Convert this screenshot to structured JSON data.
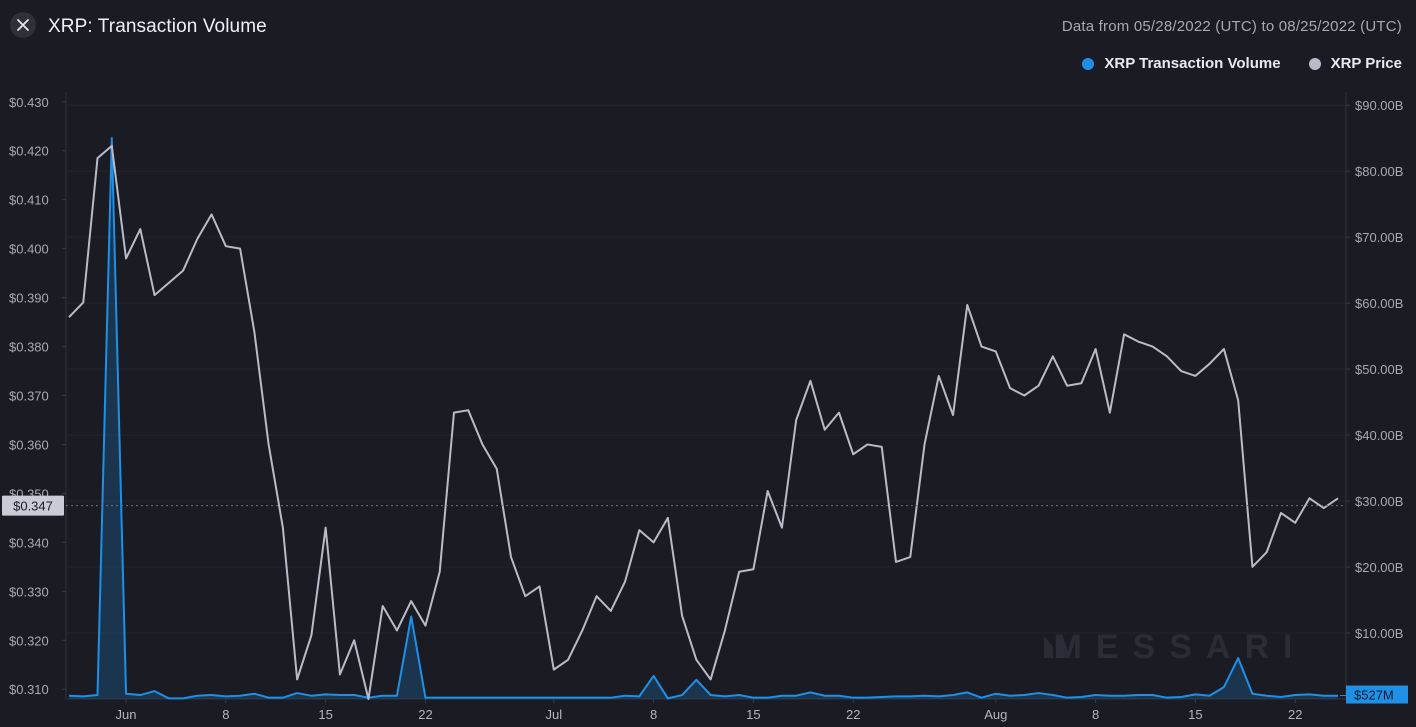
{
  "header": {
    "title": "XRP: Transaction Volume",
    "date_range": "Data from 05/28/2022 (UTC) to 08/25/2022 (UTC)",
    "close_icon": "close-icon"
  },
  "legend": [
    {
      "label": "XRP Transaction Volume",
      "color": "#1e90e8"
    },
    {
      "label": "XRP Price",
      "color": "#b9bcc8"
    }
  ],
  "watermark": "MESSARI",
  "chart_data": {
    "type": "line",
    "x_start": "2022-05-28",
    "x_end": "2022-08-25",
    "x_tick_labels": [
      {
        "date": "2022-06-01",
        "label": "Jun"
      },
      {
        "date": "2022-06-08",
        "label": "8"
      },
      {
        "date": "2022-06-15",
        "label": "15"
      },
      {
        "date": "2022-06-22",
        "label": "22"
      },
      {
        "date": "2022-07-01",
        "label": "Jul"
      },
      {
        "date": "2022-07-08",
        "label": "8"
      },
      {
        "date": "2022-07-15",
        "label": "15"
      },
      {
        "date": "2022-07-22",
        "label": "22"
      },
      {
        "date": "2022-08-01",
        "label": "Aug"
      },
      {
        "date": "2022-08-08",
        "label": "8"
      },
      {
        "date": "2022-08-15",
        "label": "15"
      },
      {
        "date": "2022-08-22",
        "label": "22"
      }
    ],
    "left_axis": {
      "ylim": [
        0.308,
        0.432
      ],
      "ticks": [
        0.31,
        0.32,
        0.33,
        0.34,
        0.35,
        0.36,
        0.37,
        0.38,
        0.39,
        0.4,
        0.41,
        0.42,
        0.43
      ],
      "tick_labels": [
        "$0.310",
        "$0.320",
        "$0.330",
        "$0.340",
        "$0.350",
        "$0.360",
        "$0.370",
        "$0.380",
        "$0.390",
        "$0.400",
        "$0.410",
        "$0.420",
        "$0.430"
      ]
    },
    "right_axis": {
      "ylim": [
        0,
        92
      ],
      "ticks": [
        10,
        20,
        30,
        40,
        50,
        60,
        70,
        80,
        90
      ],
      "tick_labels": [
        "$10.00B",
        "$20.00B",
        "$30.00B",
        "$40.00B",
        "$50.00B",
        "$60.00B",
        "$70.00B",
        "$80.00B",
        "$90.00B"
      ]
    },
    "current_price_label": "$0.347",
    "current_price_value": 0.3475,
    "current_volume_label": "$527M",
    "current_volume_value": 0.527,
    "series": [
      {
        "name": "XRP Price",
        "axis": "left",
        "color": "#b9bcc8",
        "values": [
          0.386,
          0.389,
          0.4185,
          0.421,
          0.398,
          0.404,
          0.3905,
          0.393,
          0.3955,
          0.402,
          0.407,
          0.4005,
          0.4,
          0.383,
          0.36,
          0.343,
          0.312,
          0.321,
          0.343,
          0.313,
          0.32,
          0.308,
          0.327,
          0.322,
          0.328,
          0.323,
          0.334,
          0.3665,
          0.367,
          0.36,
          0.355,
          0.337,
          0.329,
          0.331,
          0.314,
          0.316,
          0.322,
          0.329,
          0.326,
          0.332,
          0.3425,
          0.34,
          0.345,
          0.325,
          0.316,
          0.312,
          0.322,
          0.334,
          0.3345,
          0.3505,
          0.343,
          0.365,
          0.373,
          0.363,
          0.3665,
          0.358,
          0.36,
          0.3595,
          0.336,
          0.337,
          0.36,
          0.374,
          0.366,
          0.3885,
          0.38,
          0.379,
          0.3715,
          0.37,
          0.372,
          0.378,
          0.372,
          0.3725,
          0.3795,
          0.3665,
          0.3825,
          0.381,
          0.38,
          0.378,
          0.375,
          0.374,
          0.3765,
          0.3795,
          0.369,
          0.335,
          0.338,
          0.346,
          0.344,
          0.349,
          0.347,
          0.349
        ]
      },
      {
        "name": "XRP Transaction Volume",
        "axis": "right",
        "color": "#1e90e8",
        "values_billions": [
          0.5,
          0.4,
          0.6,
          85.0,
          0.8,
          0.6,
          1.2,
          0.1,
          0.1,
          0.5,
          0.6,
          0.4,
          0.5,
          0.8,
          0.2,
          0.2,
          0.9,
          0.5,
          0.7,
          0.6,
          0.6,
          0.2,
          0.5,
          0.5,
          12.5,
          0.2,
          0.2,
          0.2,
          0.2,
          0.2,
          0.2,
          0.2,
          0.2,
          0.2,
          0.2,
          0.2,
          0.2,
          0.2,
          0.2,
          0.5,
          0.4,
          3.5,
          0.1,
          0.6,
          2.9,
          0.6,
          0.4,
          0.6,
          0.2,
          0.2,
          0.5,
          0.5,
          1.0,
          0.5,
          0.5,
          0.2,
          0.2,
          0.3,
          0.4,
          0.4,
          0.5,
          0.4,
          0.6,
          1.0,
          0.2,
          0.8,
          0.5,
          0.6,
          0.9,
          0.6,
          0.2,
          0.3,
          0.6,
          0.5,
          0.5,
          0.6,
          0.6,
          0.2,
          0.3,
          0.7,
          0.5,
          1.8,
          6.2,
          0.8,
          0.5,
          0.3,
          0.6,
          0.7,
          0.5,
          0.5
        ]
      }
    ],
    "grid": true,
    "legend_position": "top-right"
  }
}
